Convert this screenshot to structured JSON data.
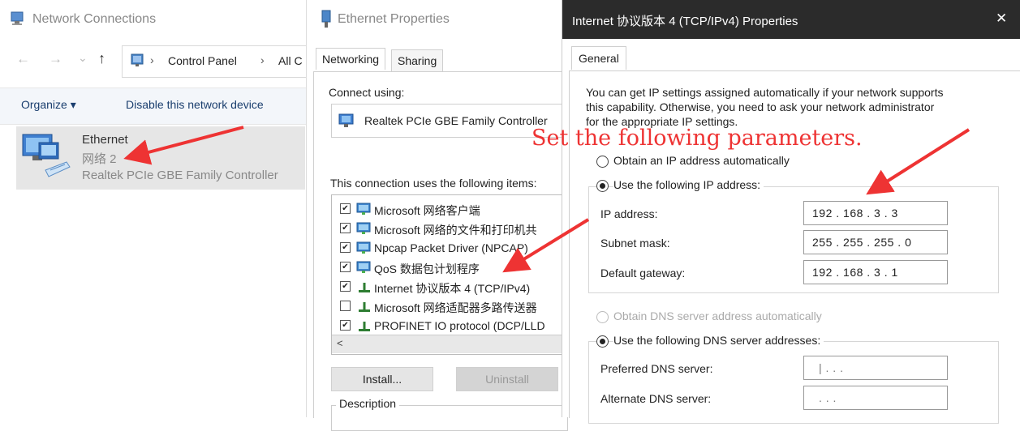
{
  "network_connections": {
    "title": "Network Connections",
    "nav": {
      "up": "↑",
      "back": "←",
      "forward": "→",
      "dropdown": "⌄"
    },
    "breadcrumb": [
      "Control Panel",
      "All C"
    ],
    "breadcrumb_sep": "›",
    "toolbar": {
      "organize": "Organize ▾",
      "disable": "Disable this network device"
    },
    "adapter": {
      "name": "Ethernet",
      "network": "网络 2",
      "device": "Realtek PCIe GBE Family Controller"
    }
  },
  "ethernet_properties": {
    "title": "Ethernet Properties",
    "tabs": [
      "Networking",
      "Sharing"
    ],
    "connect_using_label": "Connect using:",
    "adapter": "Realtek PCIe GBE Family Controller",
    "items_label": "This connection uses the following items:",
    "items": [
      {
        "label": "Microsoft 网络客户端",
        "checked": true
      },
      {
        "label": "Microsoft 网络的文件和打印机共",
        "checked": true
      },
      {
        "label": "Npcap Packet Driver (NPCAP)",
        "checked": true
      },
      {
        "label": "QoS 数据包计划程序",
        "checked": true
      },
      {
        "label": "Internet 协议版本 4 (TCP/IPv4)",
        "checked": true
      },
      {
        "label": "Microsoft 网络适配器多路传送器",
        "checked": false
      },
      {
        "label": "PROFINET IO protocol (DCP/LLD",
        "checked": true
      }
    ],
    "scroll_left": "<",
    "install": "Install...",
    "uninstall": "Uninstall",
    "description": "Description"
  },
  "ipv4": {
    "title": "Internet 协议版本 4 (TCP/IPv4) Properties",
    "close": "✕",
    "tab": "General",
    "intro": [
      "You can get IP settings assigned automatically if your network supports",
      "this capability. Otherwise, you need to ask your network administrator",
      "for the appropriate IP settings."
    ],
    "obtain_ip": "Obtain an IP address automatically",
    "use_ip": "Use the following IP address:",
    "ip_label": "IP address:",
    "ip_value": "192 .  168  .   3   .   3",
    "subnet_label": "Subnet mask:",
    "subnet_value": "255 . 255 . 255 .  0",
    "gateway_label": "Default gateway:",
    "gateway_value": "192 .  168  .   3   .   1",
    "obtain_dns": "Obtain DNS server address automatically",
    "use_dns": "Use the following DNS server addresses:",
    "pref_dns_label": "Preferred DNS server:",
    "pref_dns_value": "|    .      .      .",
    "alt_dns_label": "Alternate DNS server:",
    "alt_dns_value": "      .      .      ."
  },
  "annotation": {
    "text": "Set the following parameters.",
    "color": "#e33333"
  }
}
